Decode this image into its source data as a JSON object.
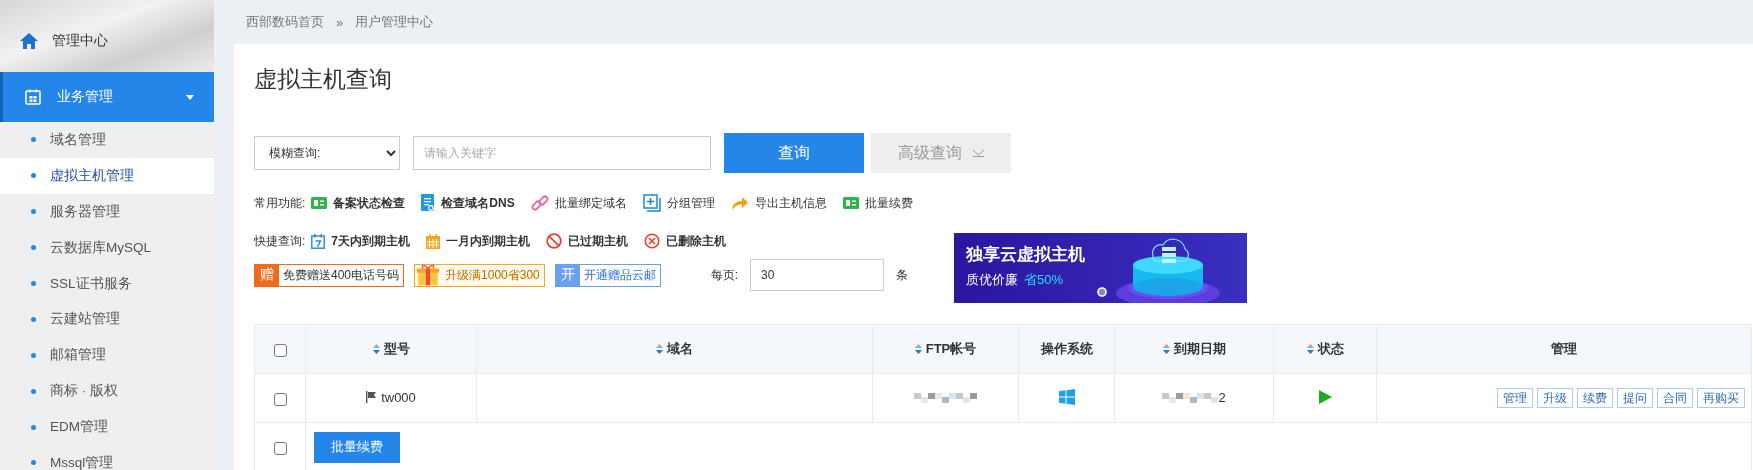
{
  "sidebar": {
    "home": {
      "label": "管理中心"
    },
    "group": {
      "label": "业务管理",
      "expanded": true
    },
    "items": [
      {
        "label": "域名管理",
        "selected": false
      },
      {
        "label": "虚拟主机管理",
        "selected": true
      },
      {
        "label": "服务器管理",
        "selected": false
      },
      {
        "label": "云数据库MySQL",
        "selected": false
      },
      {
        "label": "SSL证书服务",
        "selected": false
      },
      {
        "label": "云建站管理",
        "selected": false
      },
      {
        "label": "邮箱管理",
        "selected": false
      },
      {
        "label": "商标 · 版权",
        "selected": false
      },
      {
        "label": "EDM管理",
        "selected": false
      },
      {
        "label": "Mssql管理",
        "selected": false
      }
    ]
  },
  "breadcrumb": [
    "西部数码首页",
    "»",
    "用户管理中心"
  ],
  "page_title": "虚拟主机查询",
  "search": {
    "mode": "模糊查询:",
    "placeholder": "请输入关键字",
    "submit": "查询",
    "advanced": "高级查询"
  },
  "common_functions": {
    "label": "常用功能:",
    "items": [
      {
        "kind": "record",
        "label": "备案状态检查",
        "bold": true
      },
      {
        "kind": "dns",
        "label": "检查域名DNS",
        "bold": true
      },
      {
        "kind": "link",
        "label": "批量绑定域名",
        "bold": false
      },
      {
        "kind": "group",
        "label": "分组管理",
        "bold": false
      },
      {
        "kind": "export",
        "label": "导出主机信息",
        "bold": false
      },
      {
        "kind": "record",
        "label": "批量续费",
        "bold": false
      }
    ]
  },
  "quick_query": {
    "label": "快捷查询:",
    "items": [
      {
        "kind": "week",
        "label": "7天内到期主机"
      },
      {
        "kind": "month",
        "label": "一月内到期主机"
      },
      {
        "kind": "expired",
        "label": "已过期主机"
      },
      {
        "kind": "deleted",
        "label": "已删除主机"
      }
    ]
  },
  "promos": [
    {
      "kind": "orange",
      "tag": "赠",
      "text": "免费赠送400电话号码"
    },
    {
      "kind": "gift",
      "text": "升级满1000省300"
    },
    {
      "kind": "blue",
      "tag": "开",
      "text": "开通赠品云邮"
    }
  ],
  "page_size": {
    "label": "每页:",
    "value": "30",
    "unit": "条"
  },
  "banner": {
    "title": "独享云虚拟主机",
    "subtitle": "质优价廉",
    "highlight": "省50%"
  },
  "table": {
    "columns": [
      {
        "label": "型号",
        "sortable": true
      },
      {
        "label": "域名",
        "sortable": true
      },
      {
        "label": "FTP帐号",
        "sortable": true
      },
      {
        "label": "操作系统",
        "sortable": false
      },
      {
        "label": "到期日期",
        "sortable": true
      },
      {
        "label": "状态",
        "sortable": true
      },
      {
        "label": "管理",
        "sortable": false
      }
    ],
    "header_checked": false,
    "rows": [
      {
        "checked": false,
        "model": "tw000",
        "date_tail": "2",
        "actions": [
          "管理",
          "升级",
          "续费",
          "提问",
          "合同",
          "再购买"
        ]
      }
    ],
    "footer": {
      "checked": false,
      "button": "批量续费"
    }
  }
}
